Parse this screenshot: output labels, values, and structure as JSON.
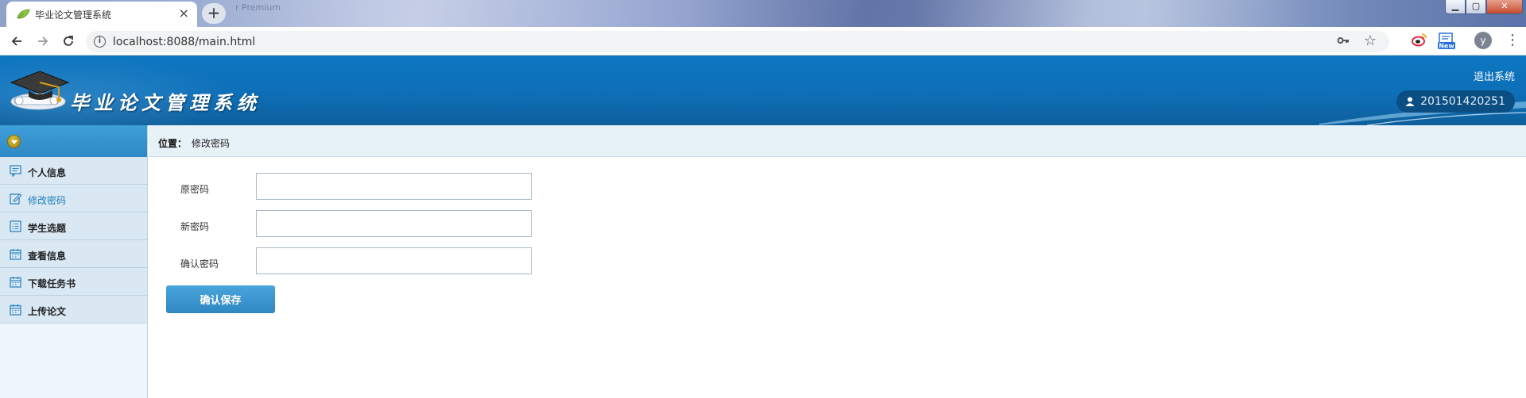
{
  "browser": {
    "tab_title": "毕业论文管理系统",
    "tab_close": "×",
    "new_tab": "+",
    "background_text": "r Premium",
    "url": "localhost:8088/main.html",
    "window_controls": {
      "minimize": "▁",
      "maximize": "▢",
      "close": "✕"
    },
    "profile_initial": "y",
    "extension_badge": "New",
    "icons": [
      "back-icon",
      "forward-icon",
      "reload-icon",
      "info-icon",
      "key-icon",
      "star-icon",
      "weibo-icon",
      "new-extension-icon",
      "menu-icon"
    ]
  },
  "header": {
    "title": "毕业论文管理系统",
    "logout": "退出系统",
    "username": "201501420251"
  },
  "sidebar": {
    "items": [
      {
        "label": "个人信息",
        "icon": "message-icon",
        "active": false
      },
      {
        "label": "修改密码",
        "icon": "edit-icon",
        "active": true
      },
      {
        "label": "学生选题",
        "icon": "list-icon",
        "active": false
      },
      {
        "label": "查看信息",
        "icon": "calendar-icon",
        "active": false
      },
      {
        "label": "下载任务书",
        "icon": "calendar-icon",
        "active": false
      },
      {
        "label": "上传论文",
        "icon": "calendar-icon",
        "active": false
      }
    ]
  },
  "breadcrumb": {
    "label": "位置：",
    "value": "修改密码"
  },
  "form": {
    "old_password_label": "原密码",
    "new_password_label": "新密码",
    "confirm_password_label": "确认密码",
    "old_password_value": "",
    "new_password_value": "",
    "confirm_password_value": "",
    "submit": "确认保存"
  },
  "colors": {
    "header_blue": "#0d6fb8",
    "sidebar_bg": "#d9e8f2",
    "active_text": "#1e7ebd",
    "button_blue": "#3a95cf"
  }
}
